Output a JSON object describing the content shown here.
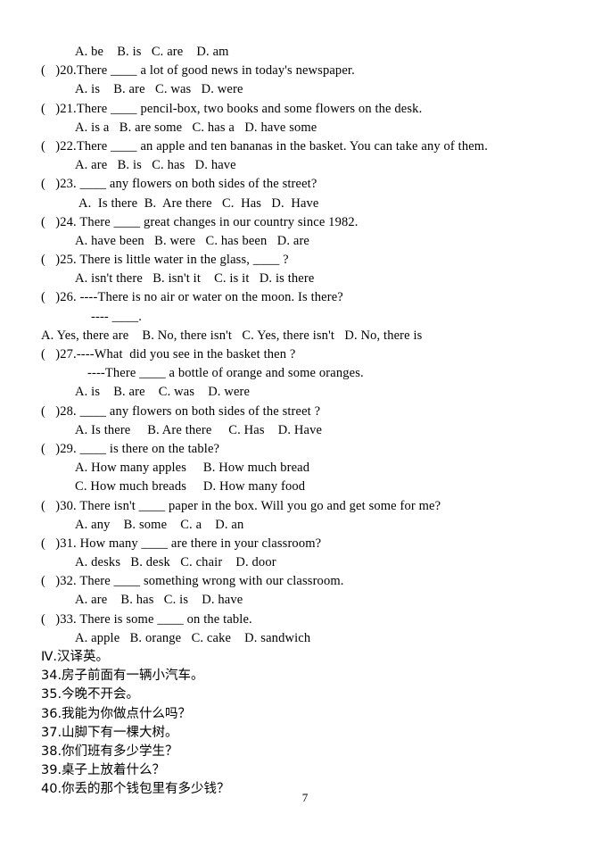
{
  "document": {
    "page_number": "7",
    "section_heading": "Ⅳ.汉译英。"
  },
  "lines": [
    {
      "kind": "options",
      "indent": "ind-opt",
      "text": "A. be    B. is   C. are    D. am"
    },
    {
      "kind": "question",
      "indent": "ind-q",
      "text": "(   )20.There ____ a lot of good news in today's newspaper."
    },
    {
      "kind": "options",
      "indent": "ind-opt",
      "text": "A. is    B. are   C. was   D. were"
    },
    {
      "kind": "question",
      "indent": "ind-q",
      "text": "(   )21.There ____ pencil-box, two books and some flowers on the desk."
    },
    {
      "kind": "options",
      "indent": "ind-opt",
      "text": "A. is a   B. are some   C. has a   D. have some"
    },
    {
      "kind": "question",
      "indent": "ind-q",
      "text": "(   )22.There ____ an apple and ten bananas in the basket. You can take any of them."
    },
    {
      "kind": "options",
      "indent": "ind-opt",
      "text": "A. are   B. is   C. has   D. have"
    },
    {
      "kind": "question",
      "indent": "ind-q",
      "text": "(   )23. ____ any flowers on both sides of the street?"
    },
    {
      "kind": "options",
      "indent": "ind-opt2",
      "text": "A.  Is there  B.  Are there   C.  Has   D.  Have"
    },
    {
      "kind": "question",
      "indent": "ind-q",
      "text": "(   )24. There ____ great changes in our country since 1982."
    },
    {
      "kind": "options",
      "indent": "ind-opt",
      "text": "A. have been   B. were   C. has been   D. are"
    },
    {
      "kind": "question",
      "indent": "ind-q",
      "text": "(   )25. There is little water in the glass, ____ ?"
    },
    {
      "kind": "options",
      "indent": "ind-opt",
      "text": "A. isn't there   B. isn't it    C. is it   D. is there"
    },
    {
      "kind": "question",
      "indent": "ind-q",
      "text": "(   )26. ----There is no air or water on the moon. Is there?"
    },
    {
      "kind": "reply",
      "indent": "ind-dash",
      "text": "---- ____."
    },
    {
      "kind": "options",
      "indent": "ind-flush",
      "text": "A. Yes, there are    B. No, there isn't   C. Yes, there isn't   D. No, there is"
    },
    {
      "kind": "question",
      "indent": "ind-q",
      "text": "(   )27.----What  did you see in the basket then ?"
    },
    {
      "kind": "reply",
      "indent": "ind-sub",
      "text": "----There ____ a bottle of orange and some oranges."
    },
    {
      "kind": "options",
      "indent": "ind-opt",
      "text": "A. is    B. are    C. was    D. were"
    },
    {
      "kind": "question",
      "indent": "ind-q",
      "text": "(   )28. ____ any flowers on both sides of the street ?"
    },
    {
      "kind": "options",
      "indent": "ind-opt",
      "text": "A. Is there     B. Are there     C. Has    D. Have"
    },
    {
      "kind": "question",
      "indent": "ind-q",
      "text": "(   )29. ____ is there on the table?"
    },
    {
      "kind": "options",
      "indent": "ind-opt",
      "text": "A. How many apples     B. How much bread"
    },
    {
      "kind": "options",
      "indent": "ind-opt",
      "text": "C. How much breads     D. How many food"
    },
    {
      "kind": "question",
      "indent": "ind-q",
      "text": "(   )30. There isn't ____ paper in the box. Will you go and get some for me?"
    },
    {
      "kind": "options",
      "indent": "ind-opt",
      "text": "A. any    B. some    C. a    D. an"
    },
    {
      "kind": "question",
      "indent": "ind-q",
      "text": "(   )31. How many ____ are there in your classroom?"
    },
    {
      "kind": "options",
      "indent": "ind-opt",
      "text": "A. desks   B. desk   C. chair    D. door"
    },
    {
      "kind": "question",
      "indent": "ind-q",
      "text": "(   )32. There ____ something wrong with our classroom."
    },
    {
      "kind": "options",
      "indent": "ind-opt",
      "text": "A. are    B. has   C. is    D. have"
    },
    {
      "kind": "question",
      "indent": "ind-q",
      "text": "(   )33. There is some ____ on the table."
    },
    {
      "kind": "options",
      "indent": "ind-opt",
      "text": "A. apple   B. orange   C. cake    D. sandwich"
    }
  ],
  "translation_section": {
    "heading": "Ⅳ.汉译英。",
    "items": [
      "34.房子前面有一辆小汽车。",
      "35.今晚不开会。",
      "36.我能为你做点什么吗？",
      "37.山脚下有一棵大树。",
      "38.你们班有多少学生？",
      "39.桌子上放着什么？",
      "40.你丢的那个钱包里有多少钱？"
    ]
  }
}
